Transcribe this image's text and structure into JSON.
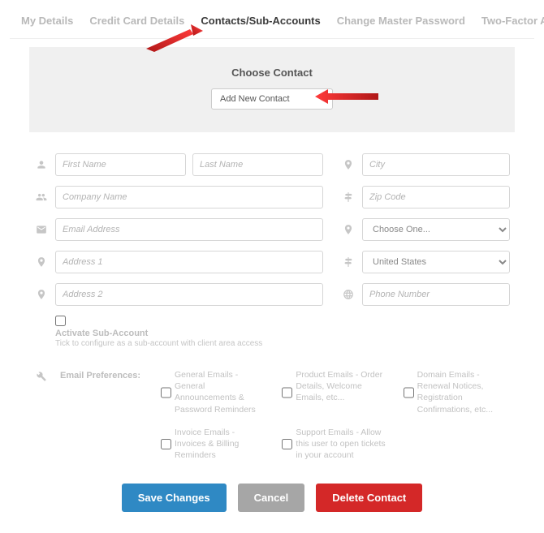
{
  "tabs": {
    "my_details": "My Details",
    "credit_card": "Credit Card Details",
    "contacts": "Contacts/Sub-Accounts",
    "change_master": "Change Master Password",
    "two_factor": "Two-Factor Authentication"
  },
  "choose": {
    "title": "Choose Contact",
    "option": "Add New Contact"
  },
  "fields": {
    "first_name": "First Name",
    "last_name": "Last Name",
    "company": "Company Name",
    "email": "Email Address",
    "address1": "Address 1",
    "address2": "Address 2",
    "city": "City",
    "zip": "Zip Code",
    "state_default": "Choose One...",
    "country_default": "United States",
    "phone": "Phone Number"
  },
  "activate": {
    "label": "Activate Sub-Account",
    "hint": "Tick to configure as a sub-account with client area access"
  },
  "prefs": {
    "title": "Email Preferences:",
    "general": "General Emails - General Announcements & Password Reminders",
    "product": "Product Emails - Order Details, Welcome Emails, etc...",
    "domain": "Domain Emails - Renewal Notices, Registration Confirmations, etc...",
    "invoice": "Invoice Emails - Invoices & Billing Reminders",
    "support": "Support Emails - Allow this user to open tickets in your account"
  },
  "buttons": {
    "save": "Save Changes",
    "cancel": "Cancel",
    "delete": "Delete Contact"
  }
}
